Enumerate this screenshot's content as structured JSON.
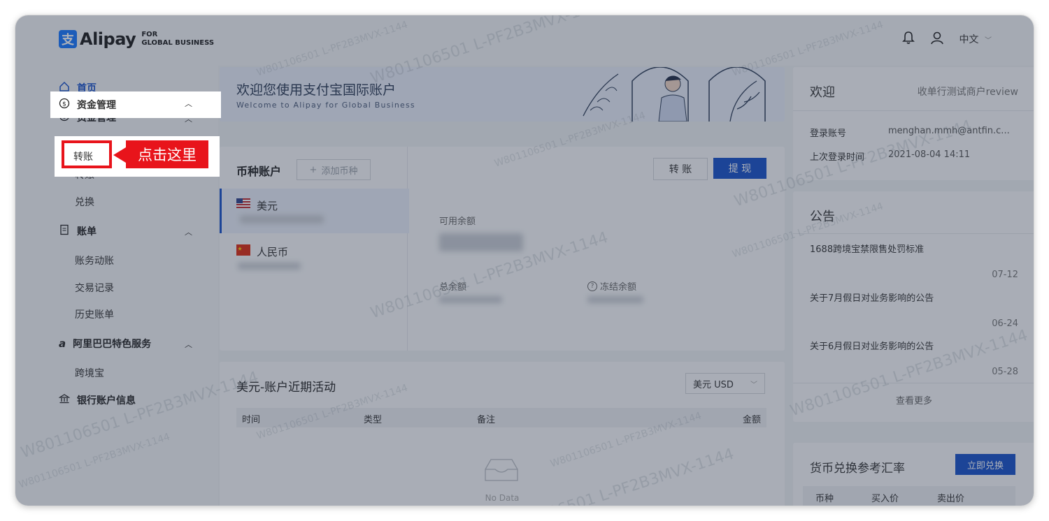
{
  "brand": {
    "logo_mark": "支",
    "name": "Alipay",
    "sub_line1": "FOR",
    "sub_line2": "GLOBAL BUSINESS"
  },
  "header": {
    "lang": "中文",
    "bell_icon": "bell-icon",
    "user_icon": "user-icon"
  },
  "sidebar": {
    "home": "首页",
    "funds": "资金管理",
    "funds_items": [
      "提现",
      "转账",
      "兑换"
    ],
    "bills": "账单",
    "bills_items": [
      "账务动账",
      "交易记录",
      "历史账单"
    ],
    "alibaba": "阿里巴巴特色服务",
    "alibaba_items": [
      "跨境宝"
    ],
    "bank": "银行账户信息"
  },
  "callout": {
    "text": "点击这里"
  },
  "banner": {
    "title": "欢迎您使用支付宝国际账户",
    "subtitle": "Welcome to Alipay for Global Business"
  },
  "accounts": {
    "title": "币种账户",
    "add_button": "添加币种",
    "currencies": [
      "美元",
      "人民币"
    ],
    "transfer_button": "转 账",
    "withdraw_button": "提 现",
    "available_label": "可用余额",
    "total_label": "总余额",
    "frozen_label": "冻结余额"
  },
  "activity": {
    "title": "美元-账户近期活动",
    "currency_select": "美元 USD",
    "columns": [
      "时间",
      "类型",
      "备注",
      "金额"
    ],
    "empty": "No Data"
  },
  "welcome": {
    "title": "欢迎",
    "merchant": "收单行测试商户review",
    "login_label": "登录账号",
    "login_value": "menghan.mmh@antfin.c...",
    "last_login_label": "上次登录时间",
    "last_login_value": "2021-08-04 14:11"
  },
  "notices": {
    "title": "公告",
    "items": [
      {
        "text": "1688跨境宝禁限售处罚标准",
        "date": "07-12"
      },
      {
        "text": "关于7月假日对业务影响的公告",
        "date": "06-24"
      },
      {
        "text": "关于6月假日对业务影响的公告",
        "date": "05-28"
      }
    ],
    "more": "查看更多"
  },
  "rates": {
    "title": "货币兑换参考汇率",
    "button": "立即兑换",
    "columns": [
      "币种",
      "买入价",
      "卖出价"
    ]
  },
  "watermark": "W801106501 L-PF2B3MVX-1144",
  "colors": {
    "primary": "#1650c8",
    "callout_red": "#e8141b",
    "dim": "rgba(40,50,70,0.38)"
  }
}
